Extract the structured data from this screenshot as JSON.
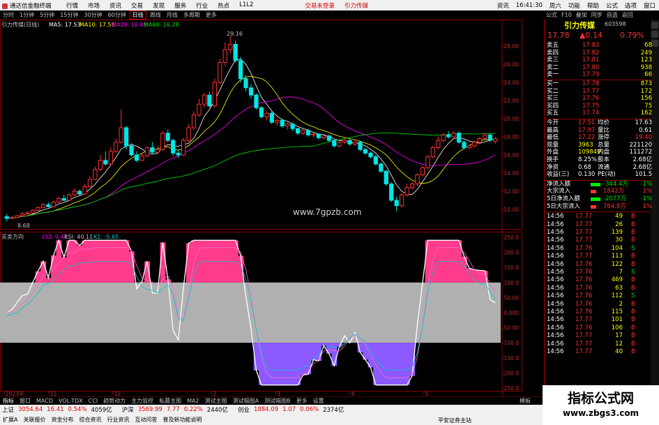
{
  "menubar": {
    "app_title": "通达信金融终端",
    "items": [
      "行情",
      "市场",
      "资讯",
      "交易",
      "发现",
      "服务",
      "行业",
      "热点",
      "L1L2"
    ],
    "trade_link": "交易未登录",
    "brand_link": "引力传媒",
    "right_items": [
      "资讯",
      "16:41:30",
      "周六",
      "功能",
      "帮助",
      "公式",
      "选项",
      "窗口"
    ]
  },
  "toolbar": {
    "items": [
      "分时",
      "1分钟",
      "5分钟",
      "15分钟",
      "30分钟",
      "60分钟",
      "日线",
      "周线",
      "月线",
      "多周期",
      "更多"
    ],
    "selected": "日线"
  },
  "toolbar_right": [
    "公式",
    "F10",
    "叠加",
    "同步",
    "自选",
    "返回"
  ],
  "stock": {
    "name": "引力传媒",
    "code": "603598",
    "price": "17.78",
    "change": "▲0.14",
    "pct": "0.79%"
  },
  "chart_info": {
    "title": "引力传媒(日线)",
    "ma5": "MA5: 17.53",
    "ma10": "MA10: 17.55",
    "ma20": "MA20: 16.05",
    "ma60": "MA60: 16.28",
    "high_label": "29.16",
    "low_label": "8.68",
    "watermark": "www.7gpzb.com",
    "sub_title": "买卖方向",
    "sub_ind": "CCI: 9.41",
    "rsi": "RSI: 40.11",
    "k1": "K1: -5.65"
  },
  "price_axis": [
    "28.00",
    "26.00",
    "24.00",
    "22.00",
    "20.00",
    "18.00",
    "16.00",
    "14.00",
    "12.00",
    "10.00"
  ],
  "ind_axis": [
    "250.0",
    "200.0",
    "150.0",
    "100.0",
    "50.00",
    "0.000",
    "-50.00",
    "-100.0",
    "-150.0",
    "-200.0",
    "-250.0"
  ],
  "date_axis": [
    "2023年",
    "11",
    "12",
    "2",
    "3",
    "4",
    "5"
  ],
  "orderbook": {
    "sells": [
      {
        "label": "卖五",
        "price": "17.83",
        "vol": "68"
      },
      {
        "label": "卖四",
        "price": "17.82",
        "vol": "249"
      },
      {
        "label": "卖三",
        "price": "17.81",
        "vol": "123"
      },
      {
        "label": "卖二",
        "price": "17.80",
        "vol": "938"
      },
      {
        "label": "卖一",
        "price": "17.79",
        "vol": "66"
      }
    ],
    "buys": [
      {
        "label": "买一",
        "price": "17.78",
        "vol": "873"
      },
      {
        "label": "买二",
        "price": "17.77",
        "vol": "172"
      },
      {
        "label": "买三",
        "price": "17.76",
        "vol": "156"
      },
      {
        "label": "买四",
        "price": "17.75",
        "vol": "75"
      },
      {
        "label": "买五",
        "price": "17.74",
        "vol": "162"
      }
    ]
  },
  "quote": [
    {
      "l1": "今开",
      "v1": "17.51",
      "l2": "均价",
      "v2": "17.63"
    },
    {
      "l1": "最高",
      "v1": "17.97",
      "l2": "量比",
      "v2": "0.61"
    },
    {
      "l1": "最低",
      "v1": "17.22",
      "l2": "涨停",
      "v2": "19.40"
    },
    {
      "l1": "现量",
      "v1": "3963",
      "l2": "总量",
      "v2": "221120"
    },
    {
      "l1": "外盘",
      "v1": "109849",
      "l2": "内盘",
      "v2": "111272"
    },
    {
      "l1": "换手",
      "v1": "8.25%",
      "l2": "股本",
      "v2": "2.68亿"
    },
    {
      "l1": "净资",
      "v1": "0.68",
      "l2": "流通",
      "v2": "2.68亿"
    },
    {
      "l1": "收益(三)",
      "v1": "0.130",
      "l2": "PE(动)",
      "v2": "101.5"
    }
  ],
  "flows": [
    {
      "label": "净流入额",
      "value": "-344.4万",
      "extra": "-1%"
    },
    {
      "label": "大宗流入",
      "value": "1842万",
      "extra": "1%"
    },
    {
      "label": "5日净流入额",
      "value": "-2077万",
      "extra": "-1%"
    },
    {
      "label": "5日大宗流入",
      "value": "764.8万",
      "extra": "1%"
    }
  ],
  "ticks": [
    {
      "t": "14:56",
      "p": "17.77",
      "v": "49",
      "d": "B"
    },
    {
      "t": "14:56",
      "p": "17.77",
      "v": "26",
      "d": "B"
    },
    {
      "t": "14:56",
      "p": "17.77",
      "v": "139",
      "d": "B"
    },
    {
      "t": "14:56",
      "p": "17.77",
      "v": "30",
      "d": "B"
    },
    {
      "t": "14:56",
      "p": "17.76",
      "v": "104",
      "d": "S"
    },
    {
      "t": "14:56",
      "p": "17.77",
      "v": "113",
      "d": "B"
    },
    {
      "t": "14:56",
      "p": "17.76",
      "v": "122",
      "d": "B"
    },
    {
      "t": "14:56",
      "p": "17.76",
      "v": "7",
      "d": "S"
    },
    {
      "t": "14:56",
      "p": "17.76",
      "v": "469",
      "d": "B"
    },
    {
      "t": "14:56",
      "p": "17.76",
      "v": "63",
      "d": "B"
    },
    {
      "t": "14:56",
      "p": "17.76",
      "v": "112",
      "d": "S"
    },
    {
      "t": "14:56",
      "p": "17.76",
      "v": "2",
      "d": "B"
    },
    {
      "t": "14:56",
      "p": "17.76",
      "v": "115",
      "d": "B"
    },
    {
      "t": "14:56",
      "p": "17.77",
      "v": "101",
      "d": "B"
    },
    {
      "t": "14:56",
      "p": "17.76",
      "v": "106",
      "d": "B"
    },
    {
      "t": "14:56",
      "p": "17.77",
      "v": "17",
      "d": "B"
    },
    {
      "t": "14:56",
      "p": "17.77",
      "v": "12",
      "d": "B"
    },
    {
      "t": "14:56",
      "p": "17.77",
      "v": "40",
      "d": "B"
    }
  ],
  "bottom_tabs": [
    "指标",
    "窗口",
    "MACD",
    "VOL-TDX",
    "CCI",
    "趋势动力",
    "主力监控",
    "私募主图",
    "MA2",
    "测试主图",
    "测试幅图A",
    "测试幅图B",
    "更多",
    "设置"
  ],
  "bottom_right": "模板",
  "status_line1": [
    {
      "name": "上证",
      "val": "3054.64",
      "chg": "16.41",
      "pct": "0.54%",
      "amt": "4059亿"
    },
    {
      "name": "沪深",
      "val": "3569.99",
      "chg": "7.77",
      "pct": "0.22%",
      "amt": "2440亿"
    },
    {
      "name": "创业",
      "val": "1884.09",
      "chg": "1.07",
      "pct": "0.06%",
      "amt": "2374亿"
    }
  ],
  "status_broker": "平安证券主站",
  "status_line2": [
    "扩展A",
    "关联报价",
    "资金分布",
    "综合资讯",
    "行业资讯",
    "互动问答",
    "普及新功能说明"
  ],
  "site_badge": {
    "t1": "指标公式网",
    "t2": "www.zbgs3.com"
  },
  "colors": {
    "up": "#ff3232",
    "down": "#00e6e6",
    "ma5": "#ffffff",
    "ma10": "#ffff00",
    "ma20": "#ff00ff",
    "ma60": "#00e600",
    "band": "#b0b0b0",
    "pink": "#ff3c8c",
    "purple": "#8c5aff"
  },
  "chart_data": {
    "type": "candlestick",
    "price_range": [
      8,
      30
    ],
    "candles": [
      {
        "o": 9.2,
        "c": 9.0,
        "h": 9.5,
        "l": 8.68
      },
      {
        "o": 9.0,
        "c": 9.1,
        "h": 9.3,
        "l": 8.9
      },
      {
        "o": 9.1,
        "c": 9.3,
        "h": 9.4,
        "l": 9.0
      },
      {
        "o": 9.3,
        "c": 9.5,
        "h": 9.7,
        "l": 9.2
      },
      {
        "o": 9.5,
        "c": 9.6,
        "h": 9.8,
        "l": 9.4
      },
      {
        "o": 9.6,
        "c": 9.9,
        "h": 10.0,
        "l": 9.5
      },
      {
        "o": 9.9,
        "c": 10.2,
        "h": 10.3,
        "l": 9.8
      },
      {
        "o": 10.2,
        "c": 10.5,
        "h": 10.7,
        "l": 10.1
      },
      {
        "o": 10.5,
        "c": 10.3,
        "h": 10.8,
        "l": 10.2
      },
      {
        "o": 10.3,
        "c": 10.8,
        "h": 11.0,
        "l": 10.2
      },
      {
        "o": 10.8,
        "c": 11.2,
        "h": 11.4,
        "l": 10.7
      },
      {
        "o": 11.2,
        "c": 11.0,
        "h": 11.6,
        "l": 10.9
      },
      {
        "o": 11.0,
        "c": 11.6,
        "h": 11.8,
        "l": 10.9
      },
      {
        "o": 11.6,
        "c": 12.0,
        "h": 12.3,
        "l": 11.5
      },
      {
        "o": 12.0,
        "c": 11.7,
        "h": 12.2,
        "l": 11.5
      },
      {
        "o": 11.7,
        "c": 12.5,
        "h": 12.8,
        "l": 11.6
      },
      {
        "o": 12.5,
        "c": 13.3,
        "h": 13.6,
        "l": 12.4
      },
      {
        "o": 13.3,
        "c": 14.4,
        "h": 14.7,
        "l": 13.2
      },
      {
        "o": 14.4,
        "c": 15.4,
        "h": 16.0,
        "l": 14.2
      },
      {
        "o": 15.4,
        "c": 15.0,
        "h": 16.4,
        "l": 14.8
      },
      {
        "o": 15.0,
        "c": 16.4,
        "h": 16.8,
        "l": 14.9
      },
      {
        "o": 16.4,
        "c": 17.4,
        "h": 17.8,
        "l": 16.2
      },
      {
        "o": 17.4,
        "c": 19.0,
        "h": 21.0,
        "l": 17.2
      },
      {
        "o": 19.0,
        "c": 17.0,
        "h": 19.2,
        "l": 16.6
      },
      {
        "o": 17.0,
        "c": 16.0,
        "h": 17.3,
        "l": 15.8
      },
      {
        "o": 16.0,
        "c": 15.4,
        "h": 16.4,
        "l": 15.2
      },
      {
        "o": 15.4,
        "c": 15.9,
        "h": 16.2,
        "l": 15.3
      },
      {
        "o": 15.9,
        "c": 16.8,
        "h": 17.0,
        "l": 15.7
      },
      {
        "o": 16.8,
        "c": 16.3,
        "h": 17.4,
        "l": 16.1
      },
      {
        "o": 16.3,
        "c": 16.6,
        "h": 17.0,
        "l": 16.0
      },
      {
        "o": 16.6,
        "c": 18.4,
        "h": 18.6,
        "l": 16.4
      },
      {
        "o": 18.4,
        "c": 17.6,
        "h": 18.8,
        "l": 17.4
      },
      {
        "o": 17.6,
        "c": 16.2,
        "h": 17.8,
        "l": 15.9
      },
      {
        "o": 16.2,
        "c": 16.0,
        "h": 16.6,
        "l": 15.7
      },
      {
        "o": 16.0,
        "c": 17.6,
        "h": 17.9,
        "l": 15.9
      },
      {
        "o": 17.6,
        "c": 19.0,
        "h": 19.4,
        "l": 17.4
      },
      {
        "o": 19.0,
        "c": 20.4,
        "h": 20.8,
        "l": 18.8
      },
      {
        "o": 20.4,
        "c": 21.6,
        "h": 22.2,
        "l": 20.2
      },
      {
        "o": 21.6,
        "c": 22.6,
        "h": 22.8,
        "l": 21.2
      },
      {
        "o": 22.6,
        "c": 21.4,
        "h": 23.0,
        "l": 21.2
      },
      {
        "o": 21.4,
        "c": 24.0,
        "h": 24.4,
        "l": 21.2
      },
      {
        "o": 24.0,
        "c": 26.2,
        "h": 26.6,
        "l": 23.8
      },
      {
        "o": 26.2,
        "c": 27.6,
        "h": 28.4,
        "l": 25.8
      },
      {
        "o": 27.6,
        "c": 28.2,
        "h": 29.16,
        "l": 27.2
      },
      {
        "o": 28.2,
        "c": 26.4,
        "h": 28.6,
        "l": 26.2
      },
      {
        "o": 26.4,
        "c": 24.4,
        "h": 26.8,
        "l": 24.0
      },
      {
        "o": 24.4,
        "c": 23.4,
        "h": 24.8,
        "l": 23.0
      },
      {
        "o": 23.4,
        "c": 22.6,
        "h": 23.8,
        "l": 22.2
      },
      {
        "o": 22.6,
        "c": 21.2,
        "h": 22.8,
        "l": 21.0
      },
      {
        "o": 21.2,
        "c": 20.2,
        "h": 21.4,
        "l": 20.0
      },
      {
        "o": 20.2,
        "c": 20.6,
        "h": 20.8,
        "l": 19.8
      },
      {
        "o": 20.6,
        "c": 19.6,
        "h": 20.8,
        "l": 19.4
      },
      {
        "o": 19.6,
        "c": 19.8,
        "h": 20.0,
        "l": 19.2
      },
      {
        "o": 19.8,
        "c": 19.2,
        "h": 20.0,
        "l": 19.0
      },
      {
        "o": 19.2,
        "c": 19.4,
        "h": 19.6,
        "l": 18.8
      },
      {
        "o": 19.4,
        "c": 18.9,
        "h": 19.6,
        "l": 18.6
      },
      {
        "o": 18.9,
        "c": 18.4,
        "h": 19.0,
        "l": 18.2
      },
      {
        "o": 18.4,
        "c": 18.7,
        "h": 18.9,
        "l": 18.2
      },
      {
        "o": 18.7,
        "c": 18.2,
        "h": 18.9,
        "l": 18.0
      },
      {
        "o": 18.2,
        "c": 18.3,
        "h": 18.5,
        "l": 17.9
      },
      {
        "o": 18.3,
        "c": 17.9,
        "h": 18.4,
        "l": 17.7
      },
      {
        "o": 17.9,
        "c": 18.1,
        "h": 18.3,
        "l": 17.7
      },
      {
        "o": 18.1,
        "c": 17.6,
        "h": 18.2,
        "l": 17.4
      },
      {
        "o": 17.6,
        "c": 17.0,
        "h": 17.8,
        "l": 16.8
      },
      {
        "o": 17.0,
        "c": 17.4,
        "h": 17.6,
        "l": 16.8
      },
      {
        "o": 17.4,
        "c": 17.6,
        "h": 17.8,
        "l": 17.2
      },
      {
        "o": 17.6,
        "c": 17.2,
        "h": 17.8,
        "l": 17.0
      },
      {
        "o": 17.2,
        "c": 17.4,
        "h": 17.6,
        "l": 17.0
      },
      {
        "o": 17.4,
        "c": 16.6,
        "h": 17.5,
        "l": 16.4
      },
      {
        "o": 16.6,
        "c": 16.2,
        "h": 16.8,
        "l": 16.0
      },
      {
        "o": 16.2,
        "c": 15.8,
        "h": 16.4,
        "l": 15.6
      },
      {
        "o": 15.8,
        "c": 15.0,
        "h": 16.0,
        "l": 14.8
      },
      {
        "o": 15.0,
        "c": 14.2,
        "h": 15.2,
        "l": 14.0
      },
      {
        "o": 14.2,
        "c": 12.8,
        "h": 14.4,
        "l": 12.6
      },
      {
        "o": 12.8,
        "c": 11.0,
        "h": 13.0,
        "l": 10.8
      },
      {
        "o": 11.0,
        "c": 10.4,
        "h": 11.4,
        "l": 9.8
      },
      {
        "o": 10.4,
        "c": 11.6,
        "h": 11.8,
        "l": 10.2
      },
      {
        "o": 11.6,
        "c": 12.4,
        "h": 12.8,
        "l": 11.4
      },
      {
        "o": 12.4,
        "c": 12.8,
        "h": 13.0,
        "l": 12.2
      },
      {
        "o": 12.8,
        "c": 13.8,
        "h": 14.0,
        "l": 12.6
      },
      {
        "o": 13.8,
        "c": 14.6,
        "h": 14.8,
        "l": 13.6
      },
      {
        "o": 14.6,
        "c": 15.8,
        "h": 16.0,
        "l": 14.4
      },
      {
        "o": 15.8,
        "c": 16.8,
        "h": 17.0,
        "l": 15.6
      },
      {
        "o": 16.8,
        "c": 17.6,
        "h": 18.0,
        "l": 16.6
      },
      {
        "o": 17.6,
        "c": 18.2,
        "h": 18.4,
        "l": 17.4
      },
      {
        "o": 18.2,
        "c": 18.0,
        "h": 18.6,
        "l": 17.8
      },
      {
        "o": 18.0,
        "c": 18.4,
        "h": 18.6,
        "l": 17.8
      },
      {
        "o": 18.4,
        "c": 17.4,
        "h": 18.6,
        "l": 17.2
      },
      {
        "o": 17.4,
        "c": 16.8,
        "h": 17.6,
        "l": 16.6
      },
      {
        "o": 16.8,
        "c": 17.0,
        "h": 17.2,
        "l": 16.6
      },
      {
        "o": 17.0,
        "c": 17.4,
        "h": 17.6,
        "l": 16.8
      },
      {
        "o": 17.4,
        "c": 17.8,
        "h": 18.0,
        "l": 17.2
      },
      {
        "o": 17.8,
        "c": 18.2,
        "h": 18.4,
        "l": 17.6
      },
      {
        "o": 18.2,
        "c": 17.64,
        "h": 18.4,
        "l": 17.4
      },
      {
        "o": 17.51,
        "c": 17.78,
        "h": 17.97,
        "l": 17.22
      }
    ]
  }
}
